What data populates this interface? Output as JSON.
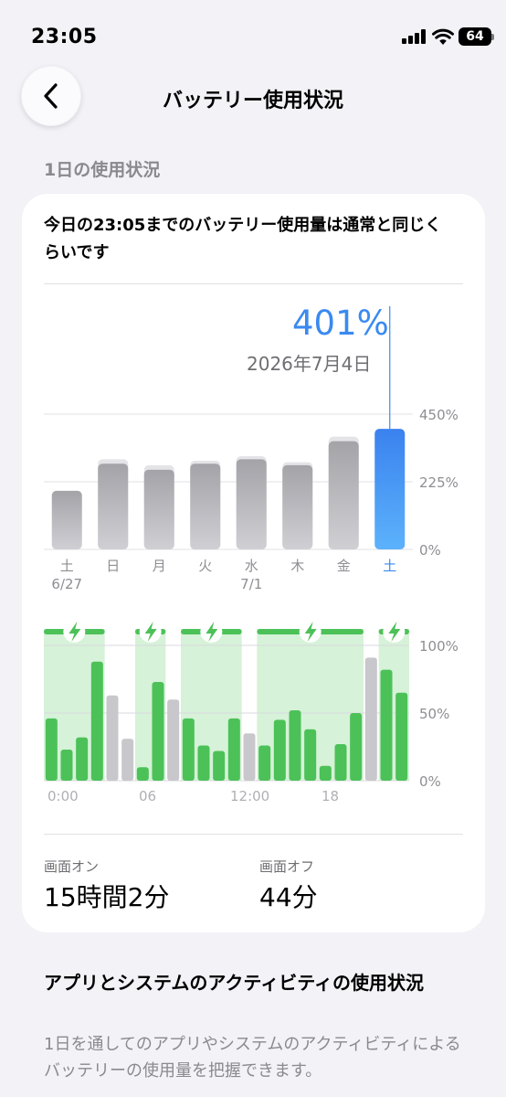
{
  "status_bar": {
    "time": "23:05",
    "battery_level": "64"
  },
  "nav": {
    "title": "バッテリー使用状況"
  },
  "section": {
    "header": "1日の使用状況"
  },
  "summary": {
    "text": "今日の23:05までのバッテリー使用量は通常と同じくらいです"
  },
  "highlight": {
    "percent": "401%",
    "date": "2026年7月4日"
  },
  "colors": {
    "accent": "#3a8af0",
    "bar_gray": "#b3b3b8",
    "green": "#4cc158",
    "green_fill": "#d6f2d8"
  },
  "chart_data": [
    {
      "type": "bar",
      "title": "",
      "categories": [
        "土",
        "日",
        "月",
        "火",
        "水",
        "木",
        "金",
        "土"
      ],
      "date_labels": [
        "6/27",
        "",
        "",
        "",
        "7/1",
        "",
        "",
        ""
      ],
      "values": [
        195,
        285,
        265,
        285,
        300,
        280,
        360,
        401
      ],
      "typical": [
        195,
        300,
        280,
        295,
        310,
        290,
        375,
        401
      ],
      "selected_index": 7,
      "y_ticks": [
        "0%",
        "225%",
        "450%"
      ],
      "ylim": [
        0,
        450
      ],
      "grid": true
    },
    {
      "type": "bar",
      "title": "",
      "x_ticks": [
        "0:00",
        "06",
        "12:00",
        "18"
      ],
      "y_ticks": [
        "0%",
        "50%",
        "100%"
      ],
      "ylim": [
        0,
        100
      ],
      "series": [
        {
          "values": [
            46,
            23,
            32,
            88,
            63,
            31,
            10,
            73,
            60,
            46,
            26,
            22,
            46,
            35,
            26,
            45,
            52,
            38,
            11,
            27,
            50,
            91,
            82,
            65
          ],
          "charging": [
            true,
            true,
            true,
            true,
            false,
            false,
            true,
            true,
            false,
            true,
            true,
            true,
            true,
            false,
            true,
            true,
            true,
            true,
            true,
            true,
            true,
            false,
            true,
            true
          ]
        }
      ],
      "charging_windows": [
        [
          0,
          4
        ],
        [
          6,
          8
        ],
        [
          9,
          13
        ],
        [
          14,
          21
        ],
        [
          22,
          24
        ]
      ],
      "grid": true
    }
  ],
  "usage": {
    "screen_on_label": "画面オン",
    "screen_on_value": "15時間2分",
    "screen_off_label": "画面オフ",
    "screen_off_value": "44分"
  },
  "activity": {
    "title": "アプリとシステムのアクティビティの使用状況",
    "description": "1日を通してのアプリやシステムのアクティビティによるバッテリーの使用量を把握できます。"
  }
}
